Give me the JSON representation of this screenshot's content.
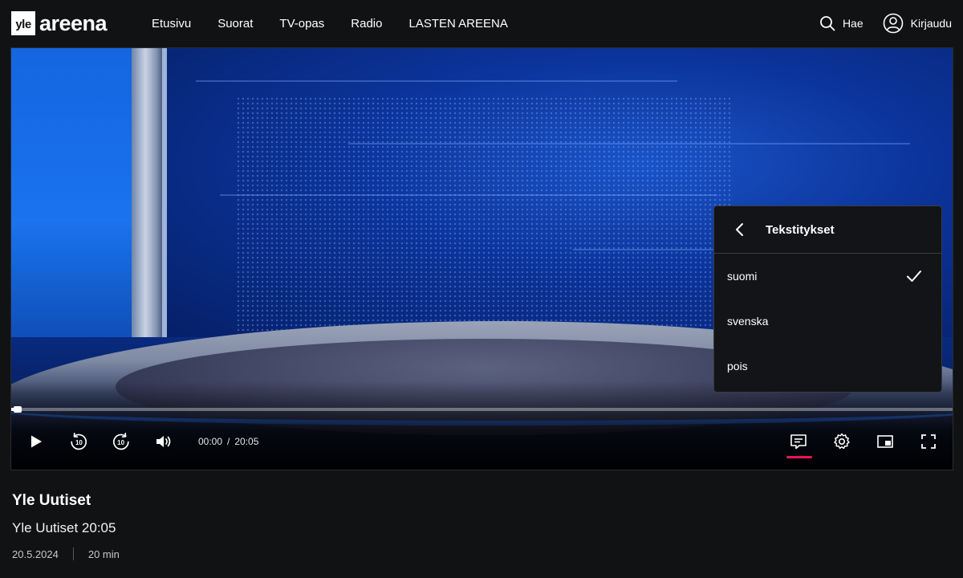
{
  "brand": {
    "logo_badge": "yle",
    "logo_text": "areena"
  },
  "nav": {
    "items": [
      {
        "label": "Etusivu"
      },
      {
        "label": "Suorat"
      },
      {
        "label": "TV-opas"
      },
      {
        "label": "Radio"
      },
      {
        "label": "LASTEN AREENA"
      }
    ]
  },
  "header": {
    "search_label": "Hae",
    "login_label": "Kirjaudu"
  },
  "player": {
    "progress_fraction": 0.004,
    "time_current": "00:00",
    "time_separator": "/",
    "time_total": "20:05",
    "accent_color": "#e6155a",
    "controls": {
      "play_icon": "play-icon",
      "rewind_icon": "rewind-10-icon",
      "forward_icon": "forward-10-icon",
      "volume_icon": "volume-icon",
      "subtitles_icon": "subtitles-icon",
      "settings_icon": "gear-icon",
      "pip_icon": "picture-in-picture-icon",
      "fullscreen_icon": "fullscreen-icon"
    }
  },
  "subtitles_menu": {
    "title": "Tekstitykset",
    "options": [
      {
        "label": "suomi",
        "selected": true
      },
      {
        "label": "svenska",
        "selected": false
      },
      {
        "label": "pois",
        "selected": false
      }
    ]
  },
  "program": {
    "series_title": "Yle Uutiset",
    "episode_title": "Yle Uutiset 20:05",
    "date": "20.5.2024",
    "duration": "20 min"
  }
}
